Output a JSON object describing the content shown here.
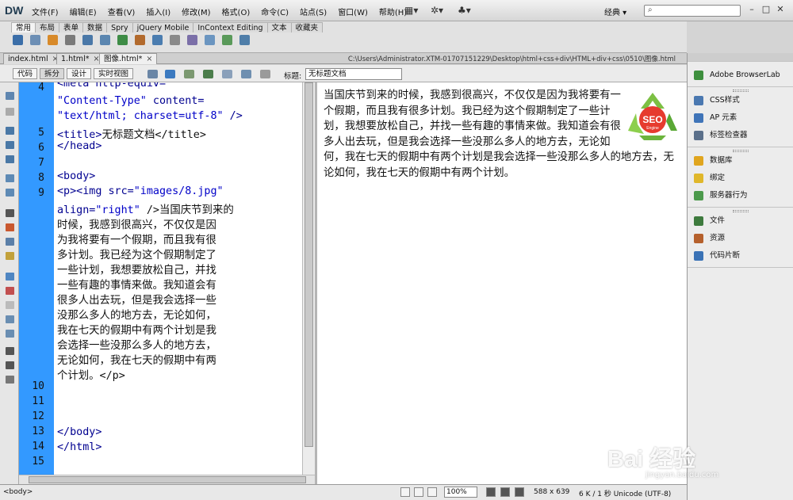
{
  "app": {
    "logo": "DW",
    "workspace": "经典 ▾"
  },
  "menu": [
    "文件(F)",
    "编辑(E)",
    "查看(V)",
    "插入(I)",
    "修改(M)",
    "格式(O)",
    "命令(C)",
    "站点(S)",
    "窗口(W)",
    "帮助(H)"
  ],
  "insert_tabs": [
    "常用",
    "布局",
    "表单",
    "数据",
    "Spry",
    "jQuery Mobile",
    "InContext Editing",
    "文本",
    "收藏夹"
  ],
  "doc_tabs": [
    {
      "label": "index.html",
      "close": "×"
    },
    {
      "label": "1.html*",
      "close": "×"
    },
    {
      "label": "图像.html*",
      "close": "×"
    }
  ],
  "file_path": "C:\\Users\\Administrator.XTM-01707151229\\Desktop\\html+css+div\\HTML+div+css\\0510\\图像.html",
  "view_buttons": {
    "code": "代码",
    "split": "拆分",
    "design": "设计",
    "live": "实时视图"
  },
  "title_field": {
    "label": "标题:",
    "value": "无标题文档"
  },
  "line_numbers": [
    "4",
    "5",
    "6",
    "7",
    "8",
    "9",
    "10",
    "11",
    "12",
    "13",
    "14",
    "15"
  ],
  "code_lines": [
    {
      "tag": "<meta http-equiv=",
      "attr": "",
      "val": "",
      "text": ""
    },
    {
      "tag": "",
      "attr": "",
      "val": "\"Content-Type\"",
      "text": " content="
    },
    {
      "tag": "",
      "attr": "",
      "val": "\"text/html; charset=utf-8\"",
      "text": " />"
    },
    {
      "tag": "<title>",
      "attr": "",
      "val": "",
      "text": "无标题文档</title>"
    },
    {
      "tag": "</head>",
      "attr": "",
      "val": "",
      "text": ""
    },
    {
      "tag": "",
      "attr": "",
      "val": "",
      "text": ""
    },
    {
      "tag": "<body>",
      "attr": "",
      "val": "",
      "text": ""
    },
    {
      "tag": "<p><img src=",
      "attr": "",
      "val": "\"images/8.jpg\"",
      "text": ""
    },
    {
      "tag": "align=",
      "attr": "",
      "val": "\"right\"",
      "text": " />当国庆节到来的"
    },
    {
      "tag": "",
      "attr": "",
      "val": "",
      "text": "时候，我感到很高兴，不仅仅是因"
    },
    {
      "tag": "",
      "attr": "",
      "val": "",
      "text": "为我将要有一个假期，而且我有很"
    },
    {
      "tag": "",
      "attr": "",
      "val": "",
      "text": "多计划。我已经为这个假期制定了"
    },
    {
      "tag": "",
      "attr": "",
      "val": "",
      "text": "一些计划，我想要放松自己，并找"
    },
    {
      "tag": "",
      "attr": "",
      "val": "",
      "text": "一些有趣的事情来做。我知道会有"
    },
    {
      "tag": "",
      "attr": "",
      "val": "",
      "text": "很多人出去玩，但是我会选择一些"
    },
    {
      "tag": "",
      "attr": "",
      "val": "",
      "text": "没那么多人的地方去，无论如何，"
    },
    {
      "tag": "",
      "attr": "",
      "val": "",
      "text": "我在七天的假期中有两个计划是我"
    },
    {
      "tag": "",
      "attr": "",
      "val": "",
      "text": "会选择一些没那么多人的地方去，"
    },
    {
      "tag": "",
      "attr": "",
      "val": "",
      "text": "无论如何，我在七天的假期中有两"
    },
    {
      "tag": "",
      "attr": "",
      "val": "",
      "text": "个计划。</p>"
    },
    {
      "tag": "",
      "attr": "",
      "val": "",
      "text": ""
    },
    {
      "tag": "",
      "attr": "",
      "val": "",
      "text": ""
    },
    {
      "tag": "",
      "attr": "",
      "val": "",
      "text": ""
    },
    {
      "tag": "</body>",
      "attr": "",
      "val": "",
      "text": ""
    },
    {
      "tag": "</html>",
      "attr": "",
      "val": "",
      "text": ""
    }
  ],
  "design_text": "当国庆节到来的时候，我感到很高兴，不仅仅是因为我将要有一个假期，而且我有很多计划。我已经为这个假期制定了一些计划，我想要放松自己，并找一些有趣的事情来做。我知道会有很多人出去玩，但是我会选择一些没那么多人的地方去，无论如何，我在七天的假期中有两个计划是我会选择一些没那么多人的地方去，无论如何，我在七天的假期中有两个计划。",
  "seo_logo": {
    "word": "SEO",
    "sub": "Engine"
  },
  "status": {
    "tag": "<body>",
    "zoom": "100%",
    "dims": "588 x 639",
    "size": "6 K / 1 秒 Unicode (UTF-8)"
  },
  "panels": {
    "group1": [
      "Adobe BrowserLab"
    ],
    "group2": [
      "CSS样式",
      "AP 元素",
      "标签检查器"
    ],
    "group3": [
      "数据库",
      "绑定",
      "服务器行为"
    ],
    "group4": [
      "文件",
      "资源",
      "代码片断"
    ]
  },
  "watermark": {
    "main": "Bai 经验",
    "sub": "jingyan.baidu.com"
  },
  "colors": {
    "gutter": "#3399ff",
    "code_tag": "#000090",
    "code_value": "#0000c8"
  }
}
